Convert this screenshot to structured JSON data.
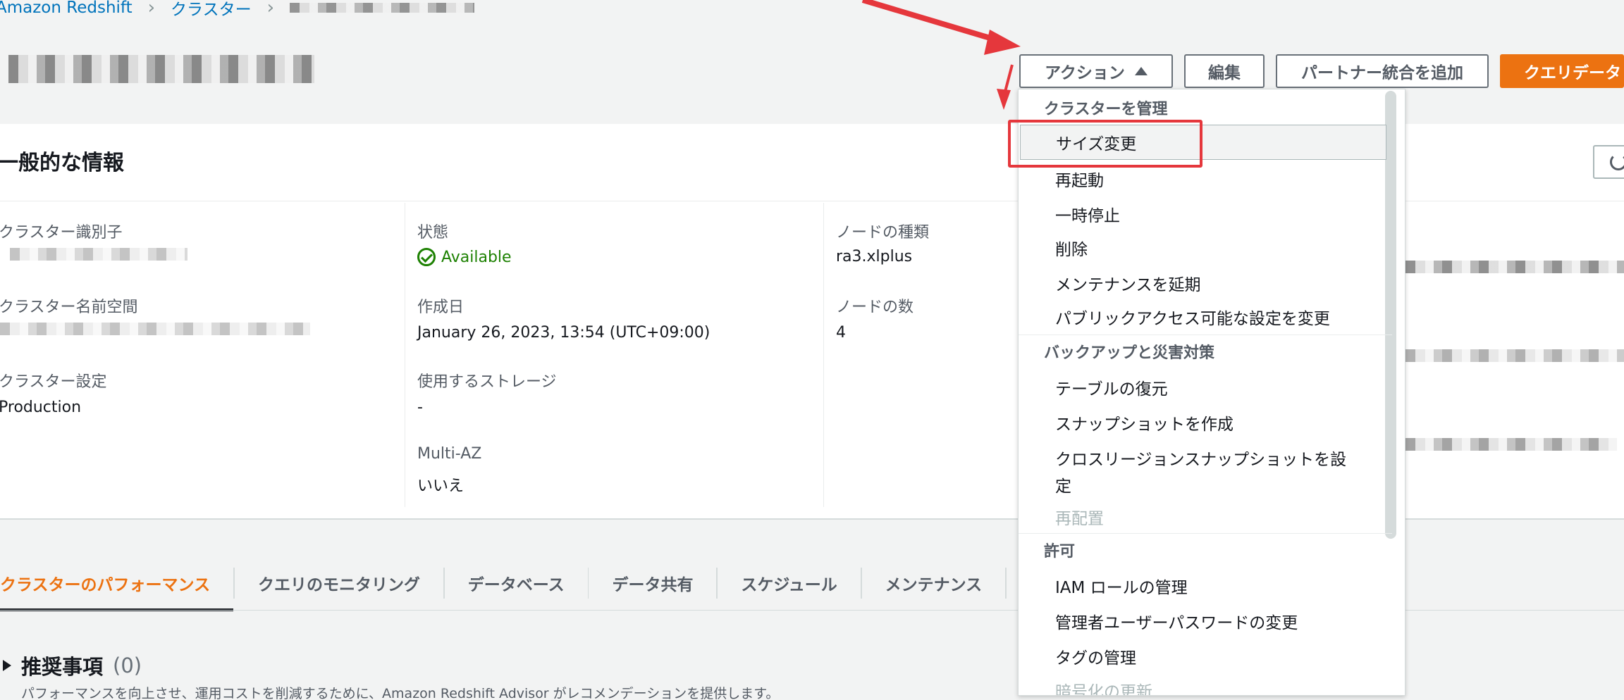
{
  "breadcrumb": {
    "root": "Amazon Redshift",
    "clusters": "クラスター"
  },
  "header": {
    "actions_label": "アクション",
    "edit_label": "編集",
    "partner_label": "パートナー統合を追加",
    "query_label": "クエリデータ"
  },
  "general": {
    "title": "一般的な情報",
    "cluster_id_label": "クラスター識別子",
    "namespace_label": "クラスター名前空間",
    "config_label": "クラスター設定",
    "config_value": "Production",
    "status_label": "状態",
    "status_value": "Available",
    "created_label": "作成日",
    "created_value": "January 26, 2023, 13:54 (UTC+09:00)",
    "storage_label": "使用するストレージ",
    "storage_value": "-",
    "multiaz_label": "Multi-AZ",
    "multiaz_value": "いいえ",
    "node_type_label": "ノードの種類",
    "node_type_value": "ra3.xlplus",
    "node_count_label": "ノードの数",
    "node_count_value": "4"
  },
  "tabs": [
    "クラスターのパフォーマンス",
    "クエリのモニタリング",
    "データベース",
    "データ共有",
    "スケジュール",
    "メンテナンス"
  ],
  "recommend": {
    "title": "推奨事項",
    "count": "(0)",
    "desc": "パフォーマンスを向上させ、運用コストを削減するために、Amazon Redshift Advisor がレコメンデーションを提供します。"
  },
  "dropdown": {
    "group_manage": "クラスターを管理",
    "resize": "サイズ変更",
    "reboot": "再起動",
    "pause": "一時停止",
    "delete": "削除",
    "defer_maintenance": "メンテナンスを延期",
    "public_access": "パブリックアクセス可能な設定を変更",
    "group_backup": "バックアップと災害対策",
    "restore_table": "テーブルの復元",
    "create_snapshot": "スナップショットを作成",
    "cross_region_1": "クロスリージョンスナップショットを設",
    "cross_region_2": "定",
    "relocate": "再配置",
    "group_permissions": "許可",
    "iam_roles": "IAM ロールの管理",
    "admin_password": "管理者ユーザーパスワードの変更",
    "tags": "タグの管理",
    "encryption": "暗号化の更新"
  },
  "colors": {
    "accent": "#ec7211",
    "link": "#0073bb",
    "success": "#1d8102",
    "annotation": "#e5373c"
  }
}
